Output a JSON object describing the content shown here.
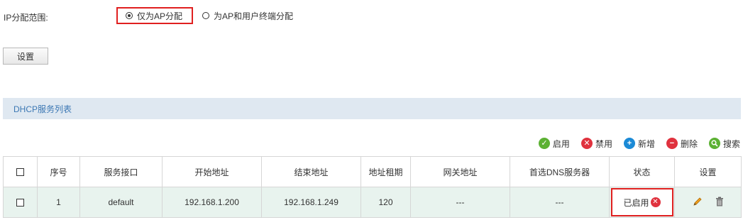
{
  "ip_range": {
    "label": "IP分配范围:",
    "options": [
      {
        "label": "仅为AP分配",
        "selected": true
      },
      {
        "label": "为AP和用户终端分配",
        "selected": false
      }
    ]
  },
  "setting_button": "设置",
  "section_title": "DHCP服务列表",
  "toolbar": {
    "enable": "启用",
    "disable": "禁用",
    "add": "新增",
    "delete": "删除",
    "search": "搜索"
  },
  "table": {
    "headers": [
      "序号",
      "服务接口",
      "开始地址",
      "结束地址",
      "地址租期",
      "网关地址",
      "首选DNS服务器",
      "状态",
      "设置"
    ],
    "rows": [
      {
        "index": "1",
        "interface": "default",
        "start": "192.168.1.200",
        "end": "192.168.1.249",
        "lease": "120",
        "gateway": "---",
        "dns": "---",
        "status": "已启用"
      }
    ]
  },
  "colors": {
    "highlight_red": "#e02020",
    "header_bg": "#dfe8f1",
    "row_bg": "#e8f3ee",
    "enable_green": "#5cb133",
    "disable_red": "#e0323e",
    "add_blue": "#1b8ad6"
  }
}
